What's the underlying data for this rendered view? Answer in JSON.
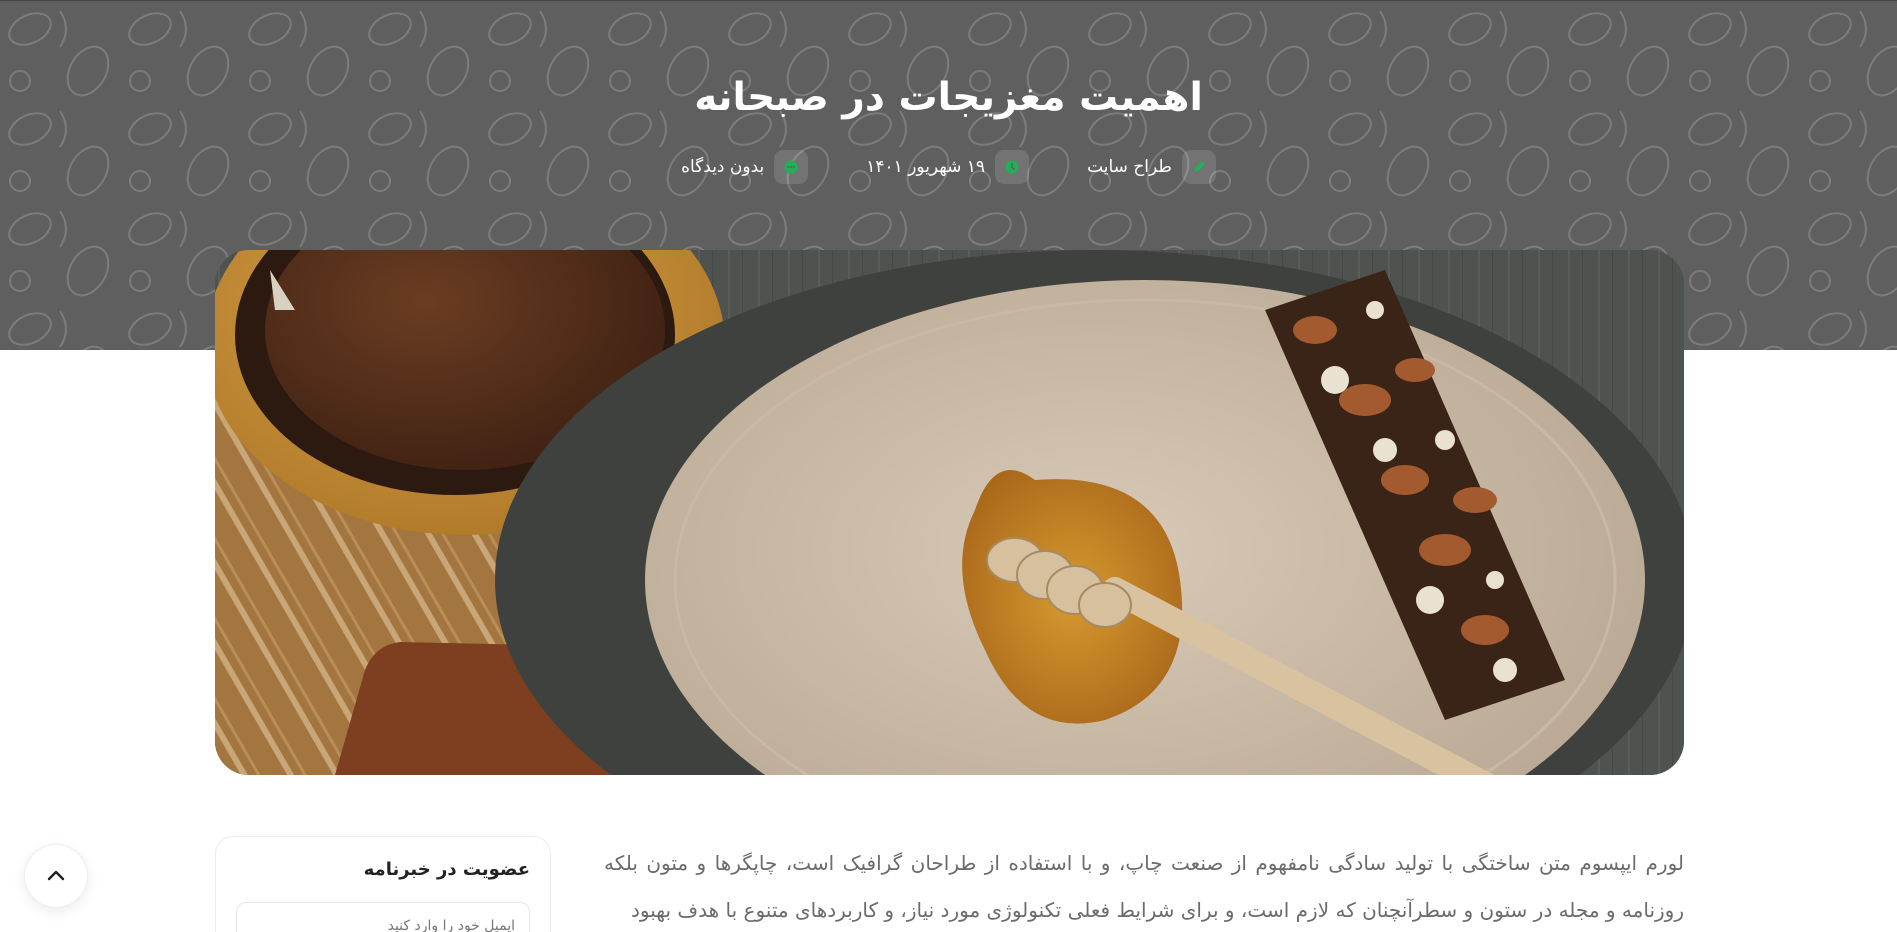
{
  "header": {
    "title": "اهمیت مغزیجات در صبحانه",
    "meta": [
      {
        "icon": "pencil-icon",
        "text": "طراح سایت"
      },
      {
        "icon": "clock-icon",
        "text": "۱۹ شهریور ۱۴۰۱"
      },
      {
        "icon": "comment-icon",
        "text": "بدون دیدگاه"
      }
    ]
  },
  "featured_image": {
    "alt": ""
  },
  "article": {
    "paragraph": "لورم ایپسوم متن ساختگی با تولید سادگی نامفهوم از صنعت چاپ، و با استفاده از طراحان گرافیک است، چاپگرها و متون بلکه روزنامه و مجله در ستون و سطرآنچنان که لازم است، و برای شرایط فعلی تکنولوژی مورد نیاز، و کاربردهای متنوع با هدف بهبود"
  },
  "sidebar": {
    "newsletter": {
      "title": "عضویت در خبرنامه",
      "placeholder": "ایمیل خود را وارد کنید"
    }
  },
  "scroll_top": {
    "icon": "chevron-up-icon"
  },
  "colors": {
    "hero_bg": "#5f5f5f",
    "accent_green": "#1fb05a",
    "text_muted": "#6b6b6b"
  }
}
